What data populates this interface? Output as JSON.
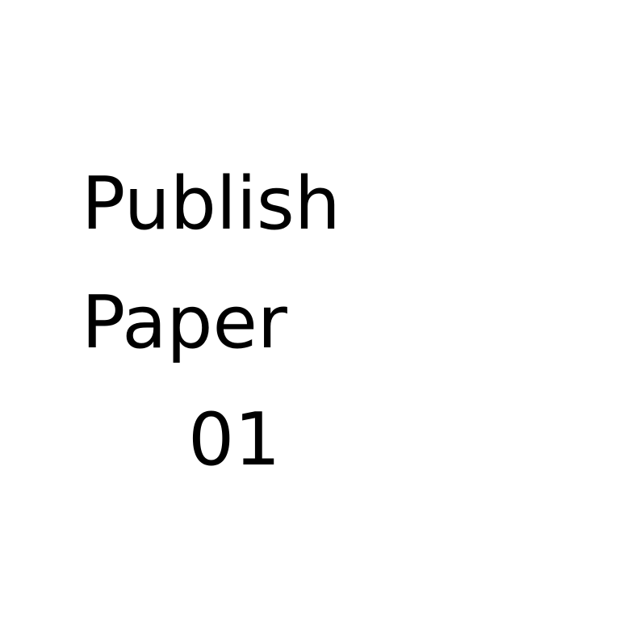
{
  "text_lines": [
    "Publish",
    "Paper",
    "01"
  ],
  "colors": {
    "background": "#ffffff",
    "text": "#000000"
  }
}
